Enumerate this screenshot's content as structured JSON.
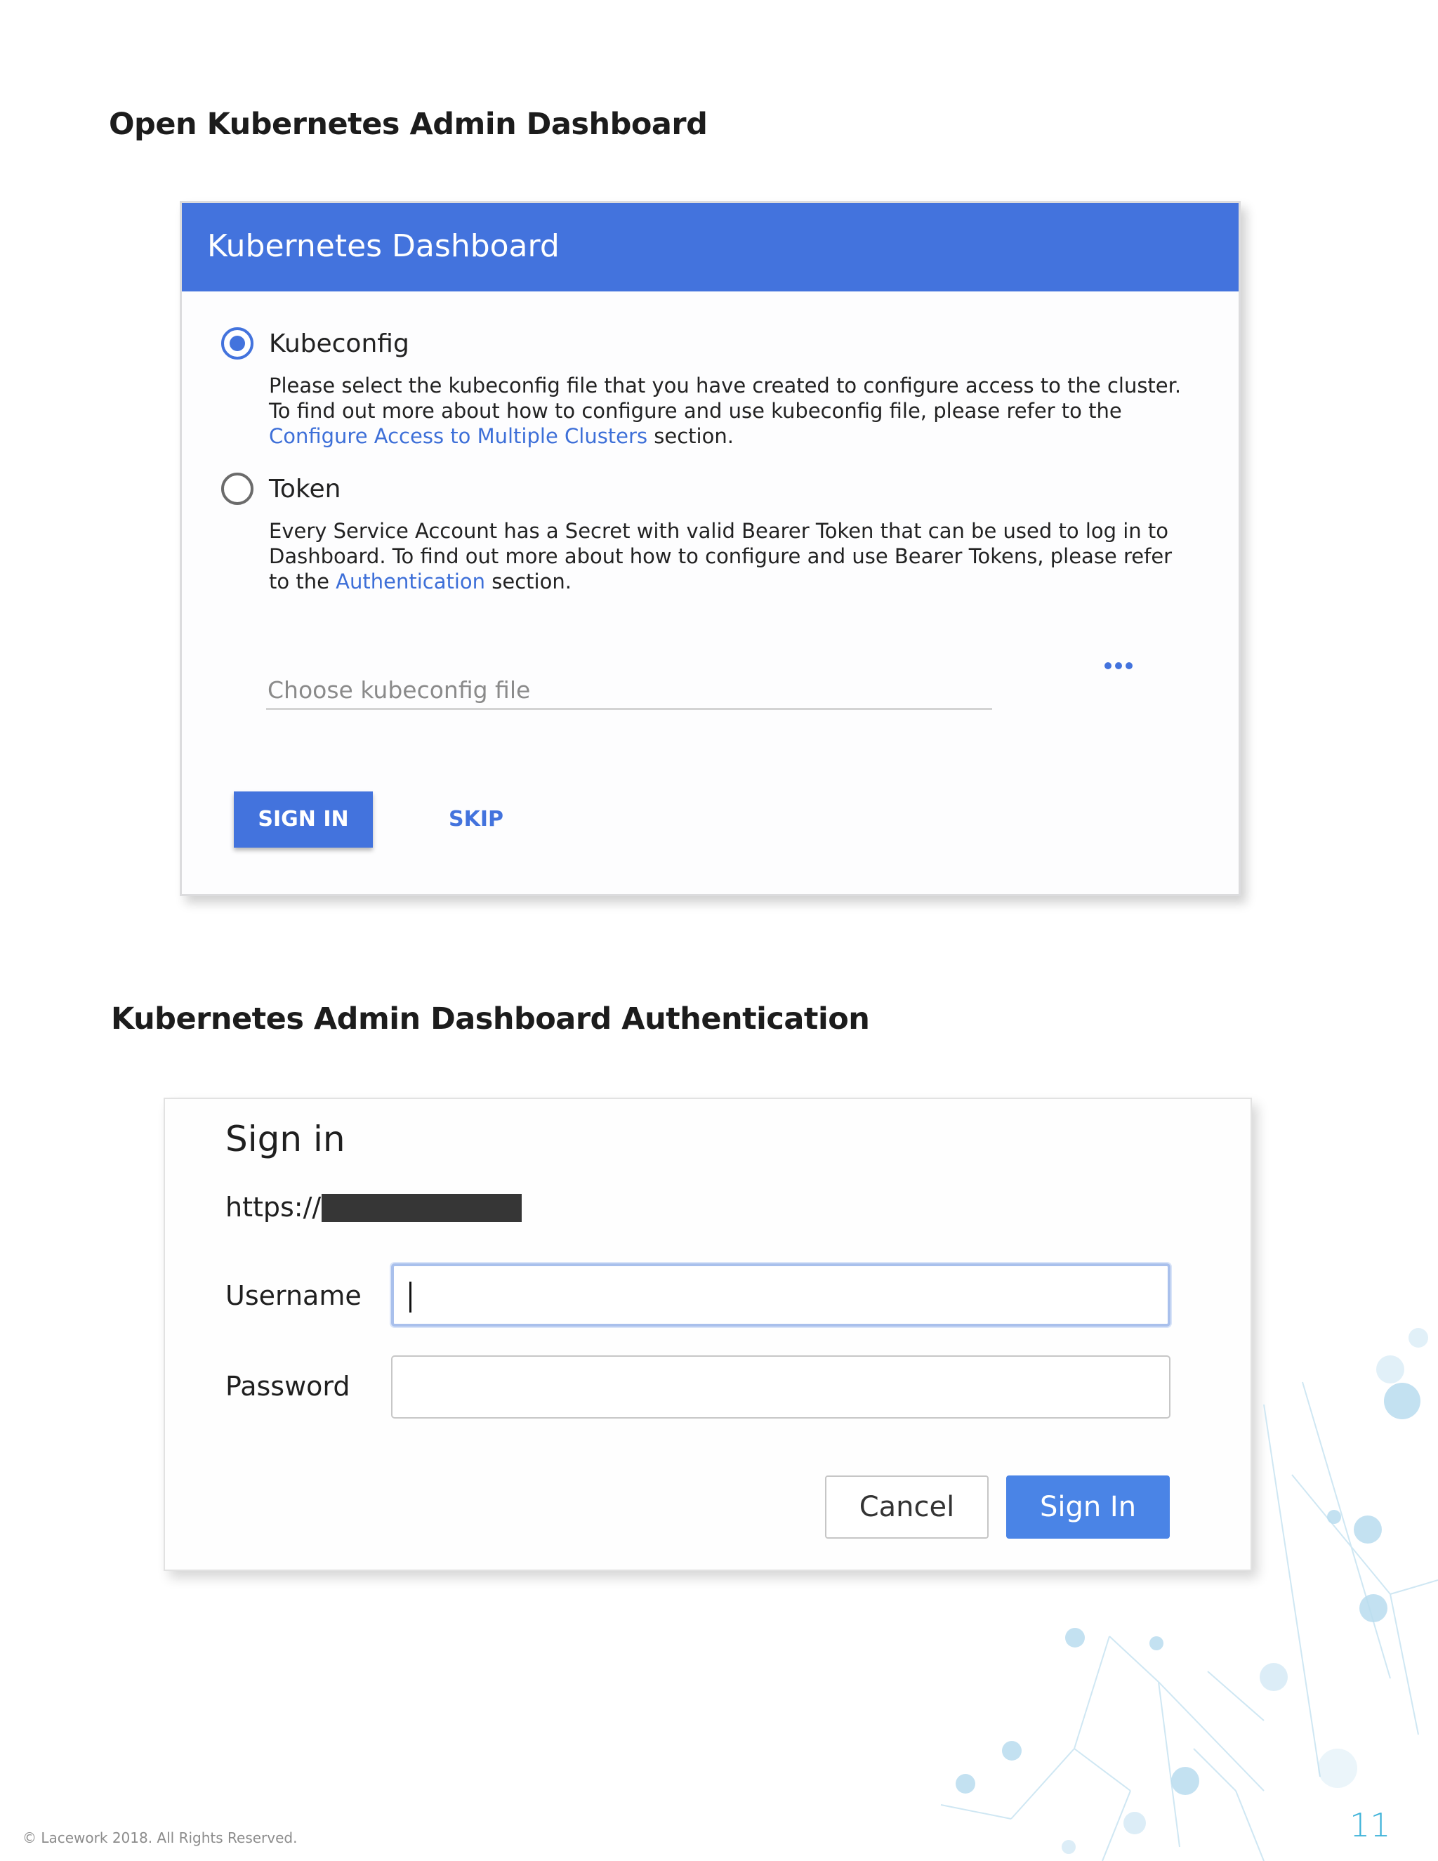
{
  "headings": {
    "first": "Open Kubernetes Admin Dashboard",
    "second": "Kubernetes Admin Dashboard Authentication"
  },
  "dashboard": {
    "title": "Kubernetes Dashboard",
    "kubeconfig": {
      "label": "Kubeconfig",
      "selected": true,
      "desc_line1": "Please select the kubeconfig file that you have created to configure access to the cluster.",
      "desc_line2": "To find out more about how to configure and use kubeconfig file, please refer to the",
      "link": "Configure Access to Multiple Clusters",
      "suffix": " section."
    },
    "token": {
      "label": "Token",
      "selected": false,
      "desc_line1": "Every Service Account has a Secret with valid Bearer Token that can be used to log in to",
      "desc_line2": "Dashboard. To find out more about how to configure and use Bearer Tokens, please refer",
      "prefix": "to the ",
      "link": "Authentication",
      "suffix": " section."
    },
    "file_placeholder": "Choose kubeconfig file",
    "more_icon": "more-horizontal-icon",
    "sign_in_label": "SIGN IN",
    "skip_label": "SKIP",
    "accent_color": "#4373dd"
  },
  "auth": {
    "title": "Sign in",
    "url": "https://",
    "username_label": "Username",
    "password_label": "Password",
    "username_value": "",
    "password_value": "",
    "cancel_label": "Cancel",
    "sign_in_label": "Sign In",
    "accent_color": "#4a84e6"
  },
  "footer": {
    "copyright": "© Lacework 2018. All Rights Reserved.",
    "page_number": "11"
  }
}
